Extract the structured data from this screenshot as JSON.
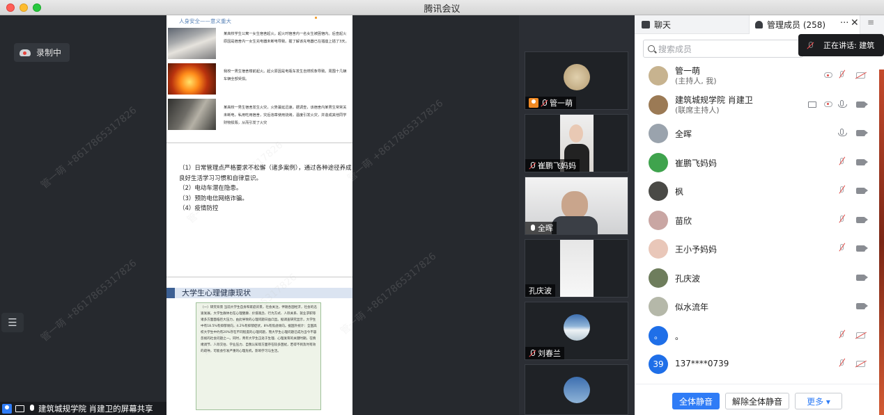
{
  "window": {
    "title": "腾讯会议"
  },
  "stage": {
    "recording_label": "录制中",
    "doc": {
      "header": "人身安全——意义重大",
      "para1": "某高校学生公寓一女生宿舍起火。起火时宿舍内一名女生被困宿内。后查起火原因是宿舍内一女生充电器未断电导致。握了解该充电器已在插座上插了3天。",
      "para2": "我校一男生宿舍楼前起火。起火原因是电瓶车发生自燃现象导致。周围十几辆车辆全部受损。",
      "para3": "某高校一男生宿舍发生火灾，火势蔓延迅速。据调查，该宿舍内某男生常常关未断电，私用吃用宿舍，灾后违章使用烧烤，温度引发火灾，并造成其他同学财物损毁，从而引发了火灾",
      "items": [
        "（1）日常管理点严格要求不松懈（诸多案例），通过各种途径养成良好生活学习习惯和自律意识。",
        "（2）电动车潜在隐患。",
        "（3）预防电信网络诈骗。",
        "（4）疫情防控"
      ],
      "section2_title": "大学生心理健康现状",
      "section2_text": "（一）研究背景 当前大学生自身和家庭背景，社会关注，伴随各国经济，社会的迅速发展，大学生群体也在心理健康、价值观念、行为方式、人际关系、就业求职等诸多方面面临巨大压力，由此导致的心理问题日益凸显。据调查研究显示，大学生中有18.5%有抑郁倾向，4.2%有抑郁症状，8%有焦虑倾向。据国外统计：全国高校大学生中约有20%存在不同程度的心理问题，而大学生心理问题已成为当今不容忽视的社会问题之一。同时，青年大学生正处于生理、心理发育的关键时期，在情绪调节、人际交往、学业压力、自我认知等方面存在较多困扰，若得不到及时有效的疏导，可能会引发严重的心理危机，影响学习与生活。"
    },
    "watermark": "管一萌 +8617865317826",
    "tiles": [
      {
        "name": "管一萌",
        "avatar_color": "#c9b48d",
        "host": true,
        "mic": "off"
      },
      {
        "name": "崔鹏飞妈妈",
        "mic": "off"
      },
      {
        "name": "全晖",
        "mic": "on"
      },
      {
        "name": "孔庆波",
        "mic": "none"
      },
      {
        "name": "刘春兰",
        "mic": "off"
      }
    ],
    "bottom_share": "建筑城规学院  肖建卫的屏幕共享"
  },
  "panel": {
    "tab_chat": "聊天",
    "tab_members": "管理成员 (258)",
    "more": "···",
    "close": "✕",
    "menu": "≡",
    "search_placeholder": "搜索成员",
    "speaking": "正在讲话: 建筑",
    "members": [
      {
        "name": "管一萌",
        "role": "(主持人, 我)",
        "avatar": "#c7b38f",
        "icons": [
          "rec",
          "mic-off",
          "cam-off"
        ]
      },
      {
        "name": "建筑城规学院  肖建卫",
        "role": "(联席主持人)",
        "avatar": "#9b7a55",
        "icons": [
          "screen",
          "rec",
          "mic-on",
          "cam"
        ]
      },
      {
        "name": "全晖",
        "role": "",
        "avatar": "#9aa3ad",
        "icons": [
          "mic-on",
          "cam"
        ]
      },
      {
        "name": "崔鹏飞妈妈",
        "role": "",
        "avatar": "#3fa34d",
        "icons": [
          "mic-off",
          "cam"
        ]
      },
      {
        "name": "枫",
        "role": "",
        "avatar": "#4a4a46",
        "icons": [
          "mic-off",
          "cam"
        ]
      },
      {
        "name": "苗欣",
        "role": "",
        "avatar": "#c9a6a3",
        "icons": [
          "mic-off",
          "cam"
        ]
      },
      {
        "name": "王小予妈妈",
        "role": "",
        "avatar": "#e9c7b9",
        "icons": [
          "mic-off",
          "cam"
        ]
      },
      {
        "name": "孔庆波",
        "role": "",
        "avatar": "#6e7d5c",
        "icons": [
          "cam"
        ]
      },
      {
        "name": "似水流年",
        "role": "",
        "avatar": "#b5b8a9",
        "icons": [
          "cam"
        ]
      },
      {
        "name": "。",
        "role": "",
        "avatar": "#1f6fe8",
        "avatar_text": "。",
        "icons": [
          "mic-off",
          "cam-off"
        ]
      },
      {
        "name": "137****0739",
        "role": "",
        "avatar": "#1f6fe8",
        "avatar_text": "39",
        "icons": [
          "mic-off",
          "cam-off"
        ]
      }
    ],
    "footer": {
      "mute_all": "全体静音",
      "unmute_all": "解除全体静音",
      "more": "更多 ▾"
    }
  }
}
